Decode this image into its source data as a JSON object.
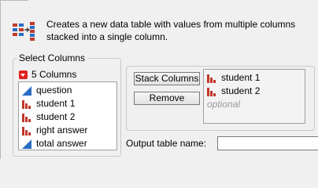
{
  "header": {
    "description": "Creates a new data table with values from multiple columns stacked into a single column."
  },
  "select_columns": {
    "title": "Select Columns",
    "count_label": "5 Columns",
    "columns": [
      {
        "name": "question",
        "type_icon": "continuous-icon"
      },
      {
        "name": "student 1",
        "type_icon": "nominal-icon"
      },
      {
        "name": "student 2",
        "type_icon": "nominal-icon"
      },
      {
        "name": "right answer",
        "type_icon": "nominal-icon"
      },
      {
        "name": "total answer",
        "type_icon": "continuous-icon"
      }
    ]
  },
  "cast": {
    "stack_button": "Stack Columns",
    "remove_button": "Remove",
    "stacked": [
      "student 1",
      "student 2"
    ],
    "optional_hint": "optional"
  },
  "output": {
    "label": "Output table name:",
    "value": ""
  },
  "colors": {
    "continuous": "#2b6cc4",
    "nominal": "#c0392b",
    "menu_red": "#e21f1f"
  }
}
